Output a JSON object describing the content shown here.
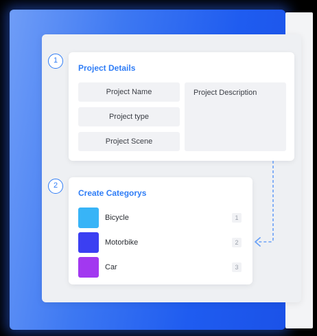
{
  "steps": [
    "1",
    "2"
  ],
  "project_details": {
    "title": "Project Details",
    "fields": {
      "project_name": "Project Name",
      "project_type": "Project type",
      "project_scene": "Project Scene",
      "project_description": "Project Description"
    }
  },
  "categories": {
    "title": "Create Categorys",
    "items": [
      {
        "label": "Bicycle",
        "index": "1",
        "color": "#38b4f7"
      },
      {
        "label": "Motorbike",
        "index": "2",
        "color": "#3b3ff2"
      },
      {
        "label": "Car",
        "index": "3",
        "color": "#a238f0"
      }
    ]
  },
  "colors": {
    "accent": "#2f7df6",
    "frame_blue": "#1f5cf0"
  }
}
